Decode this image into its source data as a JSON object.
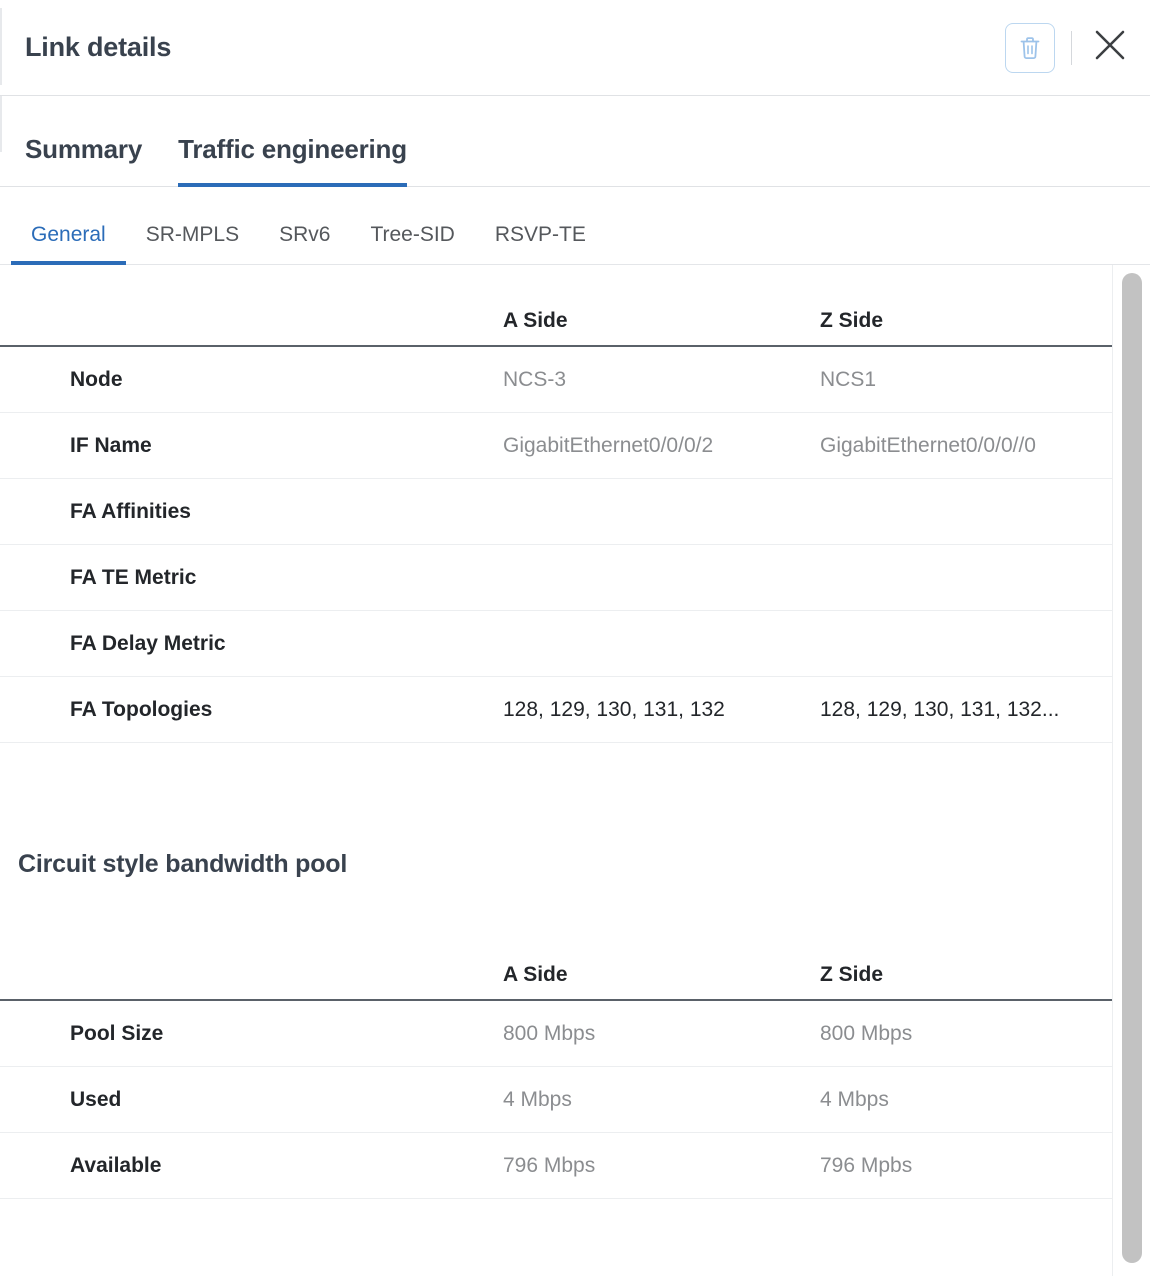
{
  "header": {
    "title": "Link details",
    "delete_icon": "trash-icon",
    "close_icon": "close-icon"
  },
  "tabs_primary": [
    {
      "label": "Summary",
      "active": false
    },
    {
      "label": "Traffic engineering",
      "active": true
    }
  ],
  "tabs_secondary": [
    {
      "label": "General",
      "active": true
    },
    {
      "label": "SR-MPLS",
      "active": false
    },
    {
      "label": "SRv6",
      "active": false
    },
    {
      "label": "Tree-SID",
      "active": false
    },
    {
      "label": "RSVP-TE",
      "active": false
    }
  ],
  "general_table": {
    "columns": {
      "label": "",
      "a": "A Side",
      "z": "Z Side"
    },
    "rows": [
      {
        "label": "Node",
        "a": "NCS-3",
        "z": "NCS1",
        "emphasis": false
      },
      {
        "label": "IF Name",
        "a": "GigabitEthernet0/0/0/2",
        "z": "GigabitEthernet0/0/0//0",
        "emphasis": false
      },
      {
        "label": "FA Affinities",
        "a": "",
        "z": "",
        "emphasis": false
      },
      {
        "label": "FA TE Metric",
        "a": "",
        "z": "",
        "emphasis": false
      },
      {
        "label": "FA Delay Metric",
        "a": "",
        "z": "",
        "emphasis": false
      },
      {
        "label": "FA Topologies",
        "a": "128, 129, 130, 131, 132",
        "z": "128, 129, 130, 131, 132...",
        "emphasis": true
      }
    ]
  },
  "bandwidth_section": {
    "title": "Circuit style bandwidth pool",
    "columns": {
      "label": "",
      "a": "A Side",
      "z": "Z Side"
    },
    "rows": [
      {
        "label": "Pool Size",
        "a": "800 Mbps",
        "z": "800 Mbps"
      },
      {
        "label": "Used",
        "a": "4 Mbps",
        "z": "4 Mbps"
      },
      {
        "label": "Available",
        "a": "796 Mbps",
        "z": "796 Mpbs"
      }
    ]
  },
  "colors": {
    "accent": "#2b6cb8",
    "title": "#39424e",
    "value": "#8b8d90",
    "rule": "#5a6169",
    "delete_icon": "#9dc3ea"
  },
  "scrollbar": {
    "name": "vertical-scrollbar"
  }
}
